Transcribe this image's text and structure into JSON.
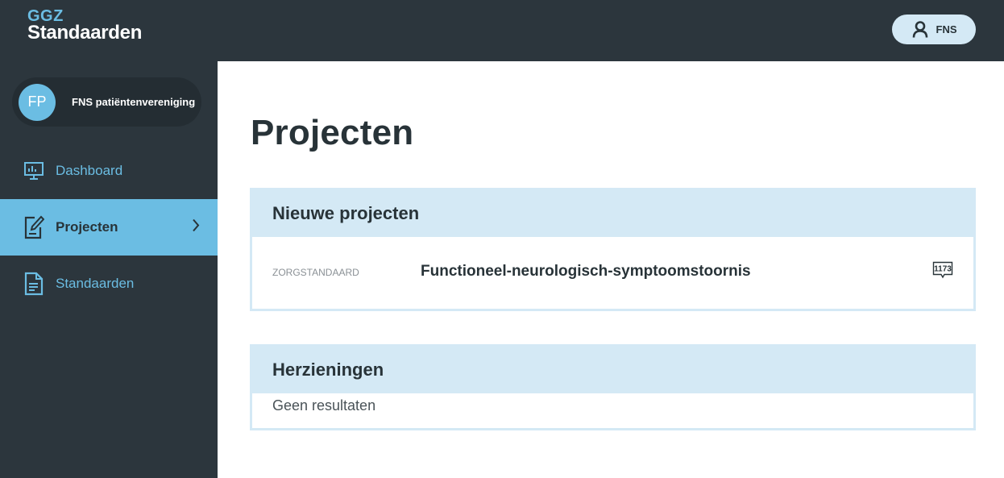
{
  "header": {
    "logo_top": "GGZ",
    "logo_bottom": "Standaarden",
    "user_label": "FNS"
  },
  "sidebar": {
    "org": {
      "initials": "FP",
      "name": "FNS patiëntenvereniging"
    },
    "items": [
      {
        "label": "Dashboard",
        "icon": "monitor-chart-icon",
        "active": false
      },
      {
        "label": "Projecten",
        "icon": "edit-document-icon",
        "active": true
      },
      {
        "label": "Standaarden",
        "icon": "document-icon",
        "active": false
      }
    ]
  },
  "main": {
    "title": "Projecten",
    "sections": [
      {
        "heading": "Nieuwe projecten",
        "rows": [
          {
            "type": "ZORGSTANDAARD",
            "title": "Functioneel-neurologisch-symptoomstoornis",
            "badge": "1173"
          }
        ]
      },
      {
        "heading": "Herzieningen",
        "empty_text": "Geen resultaten"
      }
    ]
  },
  "colors": {
    "dark": "#2c363d",
    "accent": "#6bbde3",
    "panel": "#d4e9f5",
    "text": "#283338"
  }
}
